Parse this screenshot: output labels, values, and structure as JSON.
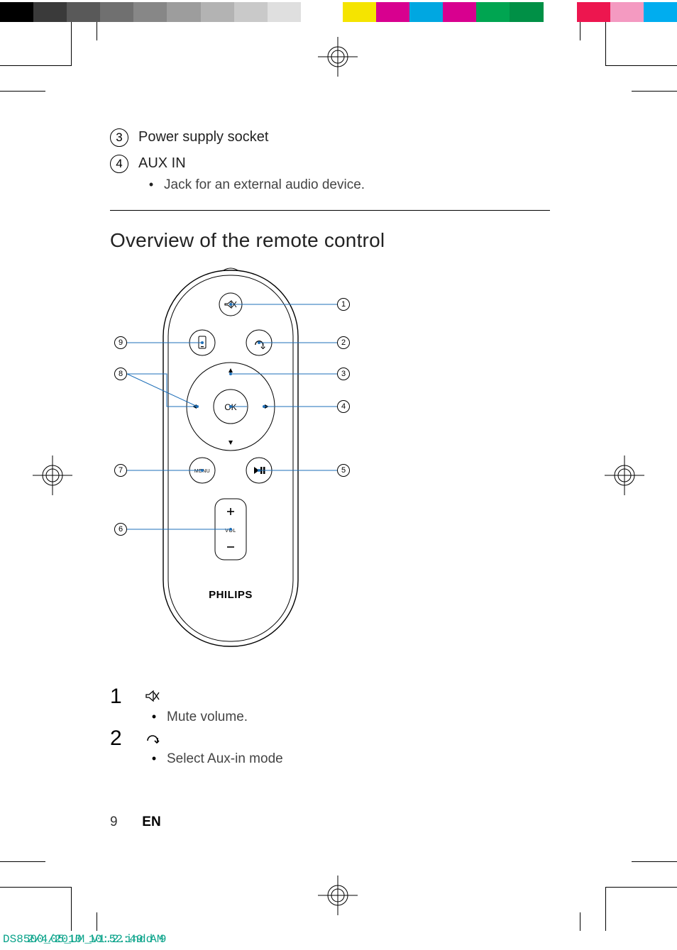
{
  "colorbar": {
    "left": [
      "#000000",
      "#3a3a3a",
      "#595959",
      "#707070",
      "#878787",
      "#9d9d9d",
      "#b3b3b3",
      "#c9c9c9",
      "#dfdfdf",
      "#ffffff"
    ],
    "right": [
      "#f5e400",
      "#d8008f",
      "#00a7e1",
      "#d8008f",
      "#00a551",
      "#009046",
      "#ffffff",
      "#ed164f",
      "#f49ac1",
      "#00adef"
    ]
  },
  "items_above": [
    {
      "num": "3",
      "title": "Power supply socket",
      "sub": []
    },
    {
      "num": "4",
      "title": "AUX IN",
      "sub": [
        "Jack for an external audio device."
      ]
    }
  ],
  "section_title": "Overview of the remote control",
  "remote": {
    "brand": "PHILIPS",
    "ok_label": "OK",
    "menu_label": "MENU",
    "vol_label": "VOL",
    "callouts_right": [
      "1",
      "2",
      "3",
      "4",
      "5"
    ],
    "callouts_left": [
      "9",
      "8",
      "7",
      "6"
    ]
  },
  "legend": [
    {
      "num": "1",
      "icon": "mute-icon",
      "sub": "Mute volume."
    },
    {
      "num": "2",
      "icon": "aux-icon",
      "sub": "Select Aux-in mode"
    }
  ],
  "footer": {
    "page": "9",
    "lang": "EN"
  },
  "slug": {
    "file": "DS8500_05_UM_V1.2.indd   9",
    "stamp": "2/4/2010   10:52:49 AM"
  }
}
